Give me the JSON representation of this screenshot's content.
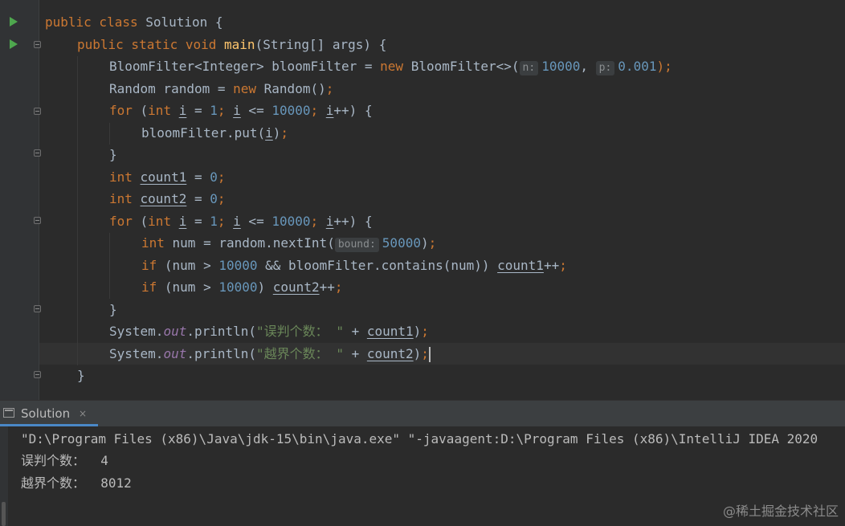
{
  "editor": {
    "lines": {
      "l1": {
        "t1": "public class ",
        "t2": "Solution {"
      },
      "l2": {
        "t1": "public static void ",
        "t2": "main",
        "t3": "(String[] args) {"
      },
      "l3": {
        "t1": "BloomFilter<Integer> bloomFilter = ",
        "t2": "new ",
        "t3": "BloomFilter<>(",
        "h1": "n:",
        "n1": "10000",
        "t4": ", ",
        "h2": "p:",
        "n2": "0.001",
        "t5": ");"
      },
      "l4": {
        "t1": "Random random = ",
        "t2": "new ",
        "t3": "Random()",
        "t4": ";"
      },
      "l5": {
        "t1": "for ",
        "t2": "(",
        "t3": "int ",
        "t4": "i",
        "t5": " = ",
        "n1": "1",
        "t6": "; ",
        "t7": "i",
        "t8": " <= ",
        "n2": "10000",
        "t9": "; ",
        "t10": "i",
        "t11": "++) {"
      },
      "l6": {
        "t1": "bloomFilter.put(",
        "t2": "i",
        "t3": ")",
        "t4": ";"
      },
      "l7": {
        "t1": "}"
      },
      "l8": {
        "t1": "int ",
        "t2": "count1",
        "t3": " = ",
        "n1": "0",
        "t4": ";"
      },
      "l9": {
        "t1": "int ",
        "t2": "count2",
        "t3": " = ",
        "n1": "0",
        "t4": ";"
      },
      "l10": {
        "t1": "for ",
        "t2": "(",
        "t3": "int ",
        "t4": "i",
        "t5": " = ",
        "n1": "1",
        "t6": "; ",
        "t7": "i",
        "t8": " <= ",
        "n2": "10000",
        "t9": "; ",
        "t10": "i",
        "t11": "++) {"
      },
      "l11": {
        "t1": "int ",
        "t2": "num = random.nextInt(",
        "h1": "bound:",
        "n1": "50000",
        "t3": ")",
        "t4": ";"
      },
      "l12": {
        "t1": "if ",
        "t2": "(num > ",
        "n1": "10000",
        "t3": " && bloomFilter.contains(num)) ",
        "t4": "count1",
        "t5": "++",
        "t6": ";"
      },
      "l13": {
        "t1": "if ",
        "t2": "(num > ",
        "n1": "10000",
        "t3": ") ",
        "t4": "count2",
        "t5": "++",
        "t6": ";"
      },
      "l14": {
        "t1": "}"
      },
      "l15": {
        "t1": "System.",
        "t2": "out",
        "t3": ".println(",
        "s1": "\"误判个数： \"",
        "t4": " + ",
        "t5": "count1",
        "t6": ")",
        "t7": ";"
      },
      "l16": {
        "t1": "System.",
        "t2": "out",
        "t3": ".println(",
        "s1": "\"越界个数： \"",
        "t4": " + ",
        "t5": "count2",
        "t6": ")",
        "t7": ";"
      },
      "l17": {
        "t1": "}"
      }
    }
  },
  "run_panel": {
    "tab_label": "Solution",
    "close_glyph": "×"
  },
  "console": {
    "lines": [
      "\"D:\\Program Files (x86)\\Java\\jdk-15\\bin\\java.exe\" \"-javaagent:D:\\Program Files (x86)\\IntelliJ IDEA 2020",
      "误判个数：  4",
      "越界个数：  8012"
    ]
  },
  "watermark": "@稀土掘金技术社区",
  "colors": {
    "background": "#2b2b2b",
    "keyword": "#cc7832",
    "number": "#6897bb",
    "method": "#ffc66d",
    "string": "#6a8759",
    "field": "#9876aa",
    "run_icon": "#4ea74e"
  },
  "icons": [
    "run-icon",
    "fold-icon",
    "console-icon",
    "close-icon"
  ]
}
